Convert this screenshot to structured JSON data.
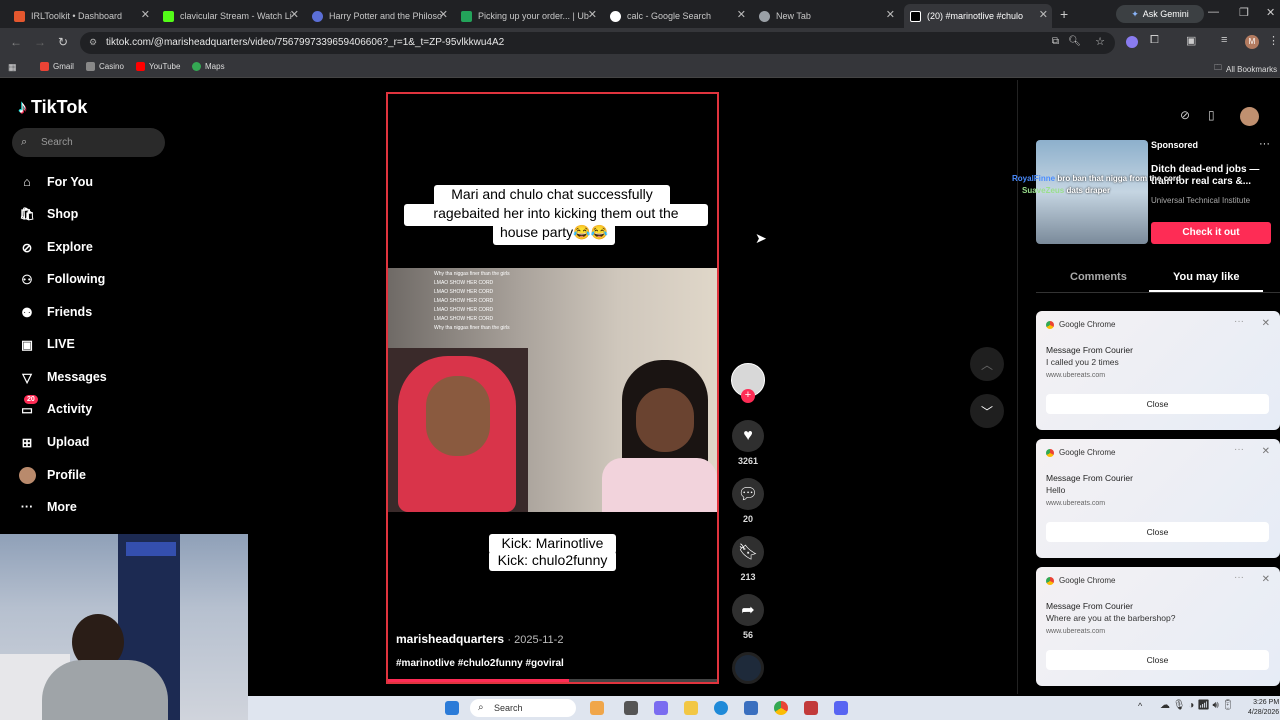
{
  "browser": {
    "tabs": [
      {
        "label": "IRLToolkit • Dashboard",
        "color": "#e4572e"
      },
      {
        "label": "clavicular Stream - Watch Li",
        "color": "#53fc18"
      },
      {
        "label": "Harry Potter and the Philoso",
        "color": "#5b6fd6"
      },
      {
        "label": "Picking up your order... | Ub",
        "color": "#23a35a"
      },
      {
        "label": "calc - Google Search",
        "color": "#ffffff"
      },
      {
        "label": "New Tab",
        "color": "#9aa0a6"
      },
      {
        "label": "(20) #marinotlive #chulo",
        "color": "#000000"
      }
    ],
    "ask_gemini": "Ask Gemini",
    "url": "tiktok.com/@marisheadquarters/video/7567997339659406606?_r=1&_t=ZP-95vlkkwu4A2",
    "bookmarks": [
      {
        "label": "Gmail",
        "color": "#ea4335"
      },
      {
        "label": "Casino",
        "color": "#888888"
      },
      {
        "label": "YouTube",
        "color": "#ff0000"
      },
      {
        "label": "Maps",
        "color": "#34a853"
      }
    ],
    "all_bookmarks": "All Bookmarks"
  },
  "tiktok": {
    "logo": "TikTok",
    "search_placeholder": "Search",
    "nav": [
      {
        "label": "For You",
        "icon": "home-icon"
      },
      {
        "label": "Shop",
        "icon": "bag-icon"
      },
      {
        "label": "Explore",
        "icon": "compass-icon"
      },
      {
        "label": "Following",
        "icon": "user-plus-icon"
      },
      {
        "label": "Friends",
        "icon": "friends-icon"
      },
      {
        "label": "LIVE",
        "icon": "live-icon"
      },
      {
        "label": "Messages",
        "icon": "messages-icon"
      },
      {
        "label": "Activity",
        "icon": "activity-icon",
        "badge": "20"
      },
      {
        "label": "Upload",
        "icon": "upload-icon"
      },
      {
        "label": "Profile",
        "icon": "profile-icon"
      },
      {
        "label": "More",
        "icon": "more-icon"
      }
    ]
  },
  "video": {
    "top_caption_1": "Mari and chulo chat successfully",
    "top_caption_2": "ragebaited her into kicking them out the",
    "top_caption_3": "house party😂😂",
    "chat_lines": [
      "Why tha niggas finer than the girls",
      "LMAO SHOW HER CORD",
      "LMAO SHOW HER CORD",
      "LMAO SHOW HER CORD",
      "LMAO SHOW HER CORD",
      "LMAO SHOW HER CORD",
      "Why tha niggas finer than the girls"
    ],
    "bottom_caption_1": "Kick: Marinotlive",
    "bottom_caption_2": "Kick: chulo2funny",
    "author": "marisheadquarters",
    "date": "· 2025-11-2",
    "hashtags": "#marinotlive #chulo2funny #goviral",
    "progress": 0.55
  },
  "actions": {
    "likes": "3261",
    "comments": "20",
    "saves": "213",
    "shares": "56"
  },
  "right": {
    "sponsored": "Sponsored",
    "ad_title": "Ditch dead-end jobs — train for real cars &...",
    "ad_sub": "Universal Technical Institute",
    "cta": "Check it out",
    "tab_comments": "Comments",
    "tab_you_may_like": "You may like",
    "overlay_chat": [
      {
        "user": "RoyalFinne",
        "text": "bro ban that nigga from the cord"
      },
      {
        "user": "SuaveZeus",
        "text": "dats draper"
      }
    ]
  },
  "notifications": [
    {
      "app": "Google Chrome",
      "title": "Message From Courier",
      "body": "I called you 2 times",
      "site": "www.ubereats.com",
      "close": "Close"
    },
    {
      "app": "Google Chrome",
      "title": "Message From Courier",
      "body": "Hello",
      "site": "www.ubereats.com",
      "close": "Close"
    },
    {
      "app": "Google Chrome",
      "title": "Message From Courier",
      "body": "Where are you at the barbershop?",
      "site": "www.ubereats.com",
      "close": "Close"
    }
  ],
  "taskbar": {
    "search": "Search",
    "time": "3:26 PM",
    "date": "4/28/2026"
  }
}
